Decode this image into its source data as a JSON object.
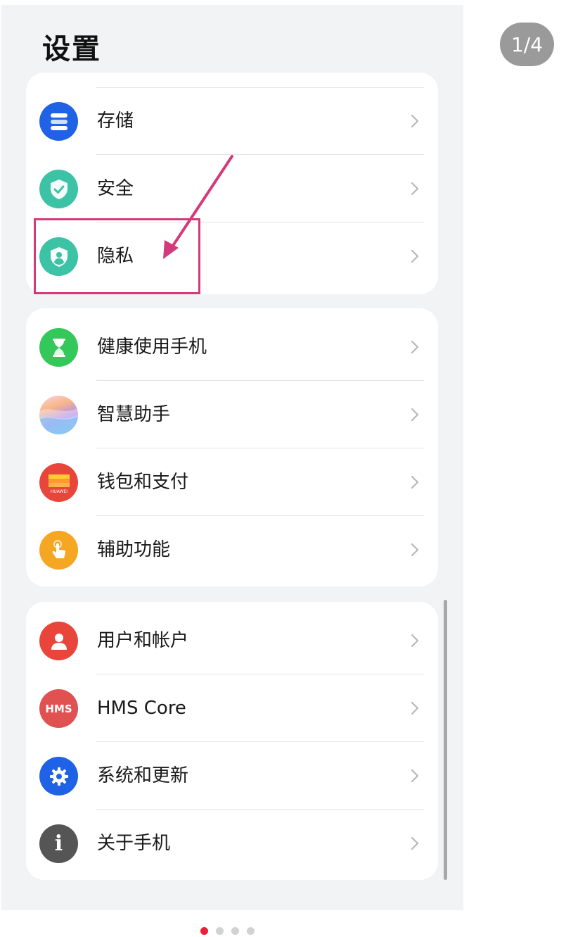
{
  "header": {
    "title": "设置"
  },
  "page_counter": "1/4",
  "groups": [
    {
      "items": [
        {
          "label": "存储",
          "icon": "storage-icon",
          "color": "#1f62e6"
        },
        {
          "label": "安全",
          "icon": "shield-check-icon",
          "color": "#3cc3a6"
        },
        {
          "label": "隐私",
          "icon": "privacy-shield-icon",
          "color": "#3cc3a6"
        }
      ]
    },
    {
      "items": [
        {
          "label": "健康使用手机",
          "icon": "hourglass-icon",
          "color": "#34c759"
        },
        {
          "label": "智慧助手",
          "icon": "assistant-icon",
          "color": "#b18cf2"
        },
        {
          "label": "钱包和支付",
          "icon": "wallet-icon",
          "color": "#e8463b",
          "icon_text": "HUAWEI"
        },
        {
          "label": "辅助功能",
          "icon": "accessibility-hand-icon",
          "color": "#f5a623"
        }
      ]
    },
    {
      "items": [
        {
          "label": "用户和帐户",
          "icon": "user-icon",
          "color": "#e8463b"
        },
        {
          "label": "HMS Core",
          "icon": "hms-icon",
          "color": "#e05252",
          "icon_text": "HMS"
        },
        {
          "label": "系统和更新",
          "icon": "gear-icon",
          "color": "#1f62e6"
        },
        {
          "label": "关于手机",
          "icon": "info-icon",
          "color": "#555555",
          "icon_text": "i"
        }
      ]
    }
  ],
  "annotation": {
    "color": "#d43a7a",
    "target": "隐私"
  },
  "pager": {
    "total": 4,
    "active": 1
  }
}
